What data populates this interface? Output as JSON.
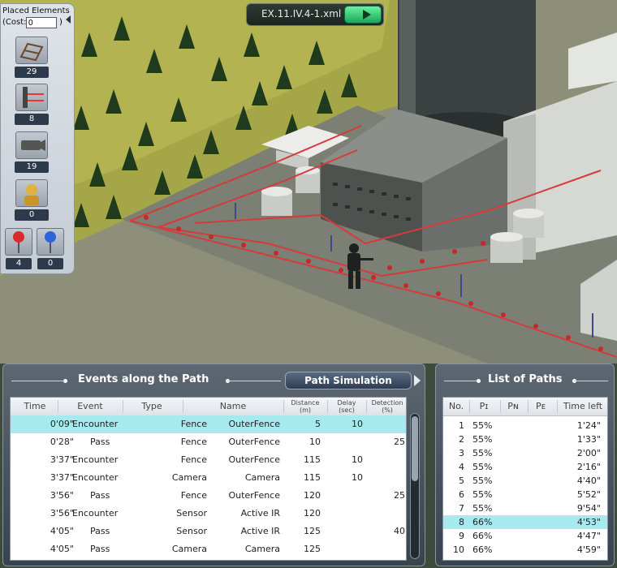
{
  "file": {
    "name": "EX.11.IV.4-1.xml"
  },
  "placed_panel": {
    "title": "Placed Elements",
    "cost_label": "(Cost:",
    "cost_value": "0",
    "cost_close": ")",
    "items": [
      {
        "icon": "fence-icon",
        "count": "29"
      },
      {
        "icon": "active-ir-sensor-icon",
        "count": "8"
      },
      {
        "icon": "camera-icon",
        "count": "19"
      },
      {
        "icon": "guard-icon",
        "count": "0"
      }
    ],
    "pins": [
      {
        "icon": "red-pin-icon",
        "count": "4"
      },
      {
        "icon": "blue-pin-icon",
        "count": "0"
      }
    ]
  },
  "events_panel": {
    "title": "Events along the Path",
    "sim_button": "Path Simulation",
    "headers": {
      "time": "Time",
      "event": "Event",
      "type": "Type",
      "name": "Name",
      "distance": "Distance",
      "distance_unit": "(m)",
      "delay": "Delay",
      "delay_unit": "(sec)",
      "detection": "Detection",
      "detection_unit": "(%)"
    },
    "rows": [
      {
        "time": "0'09\"",
        "event": "Encounter",
        "type": "Fence",
        "name": "OuterFence",
        "distance": "5",
        "delay": "10",
        "detection": ""
      },
      {
        "time": "0'28\"",
        "event": "Pass",
        "type": "Fence",
        "name": "OuterFence",
        "distance": "10",
        "delay": "",
        "detection": "25"
      },
      {
        "time": "3'37\"",
        "event": "Encounter",
        "type": "Fence",
        "name": "OuterFence",
        "distance": "115",
        "delay": "10",
        "detection": ""
      },
      {
        "time": "3'37\"",
        "event": "Encounter",
        "type": "Camera",
        "name": "Camera",
        "distance": "115",
        "delay": "10",
        "detection": ""
      },
      {
        "time": "3'56\"",
        "event": "Pass",
        "type": "Fence",
        "name": "OuterFence",
        "distance": "120",
        "delay": "",
        "detection": "25"
      },
      {
        "time": "3'56\"",
        "event": "Encounter",
        "type": "Sensor",
        "name": "Active IR",
        "distance": "120",
        "delay": "",
        "detection": ""
      },
      {
        "time": "4'05\"",
        "event": "Pass",
        "type": "Sensor",
        "name": "Active IR",
        "distance": "125",
        "delay": "",
        "detection": "40"
      },
      {
        "time": "4'05\"",
        "event": "Pass",
        "type": "Camera",
        "name": "Camera",
        "distance": "125",
        "delay": "",
        "detection": ""
      }
    ],
    "selected_row": 0
  },
  "paths_panel": {
    "title": "List of Paths",
    "headers": {
      "no": "No.",
      "pi": "Pɪ",
      "pn": "Pɴ",
      "pe": "Pᴇ",
      "time_left": "Time left"
    },
    "rows": [
      {
        "no": "1",
        "pi": "55%",
        "pn": "",
        "pe": "",
        "time_left": "1'24\""
      },
      {
        "no": "2",
        "pi": "55%",
        "pn": "",
        "pe": "",
        "time_left": "1'33\""
      },
      {
        "no": "3",
        "pi": "55%",
        "pn": "",
        "pe": "",
        "time_left": "2'00\""
      },
      {
        "no": "4",
        "pi": "55%",
        "pn": "",
        "pe": "",
        "time_left": "2'16\""
      },
      {
        "no": "5",
        "pi": "55%",
        "pn": "",
        "pe": "",
        "time_left": "4'40\""
      },
      {
        "no": "6",
        "pi": "55%",
        "pn": "",
        "pe": "",
        "time_left": "5'52\""
      },
      {
        "no": "7",
        "pi": "55%",
        "pn": "",
        "pe": "",
        "time_left": "9'54\""
      },
      {
        "no": "8",
        "pi": "66%",
        "pn": "",
        "pe": "",
        "time_left": "4'53\""
      },
      {
        "no": "9",
        "pi": "66%",
        "pn": "",
        "pe": "",
        "time_left": "4'47\""
      },
      {
        "no": "10",
        "pi": "66%",
        "pn": "",
        "pe": "",
        "time_left": "4'59\""
      }
    ],
    "selected_row": 7
  },
  "colors": {
    "selection": "#a6e9ee",
    "fence": "#d63a3a",
    "play_button": "#2ec36e"
  }
}
